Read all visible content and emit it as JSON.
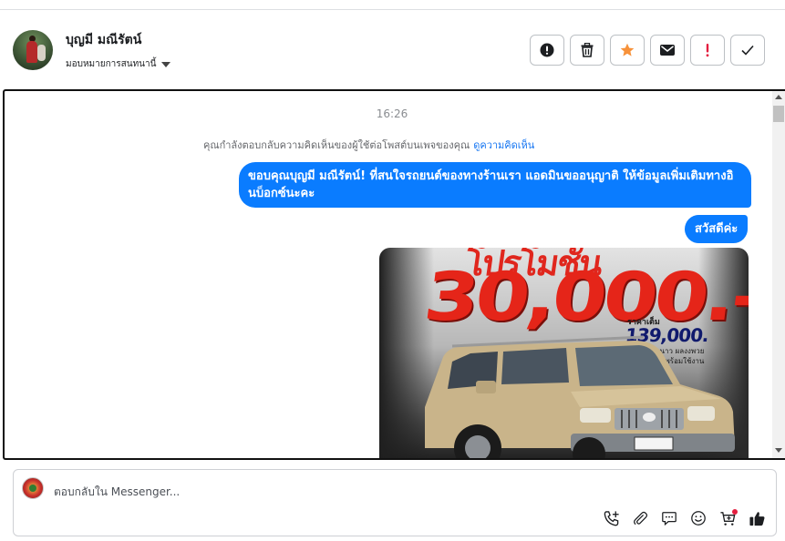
{
  "header": {
    "contact_name": "บุญมี มณีรัตน์",
    "assign_label": "มอบหมายการสนทนานี้",
    "actions": [
      {
        "name": "spam",
        "icon": "alert-circle-icon"
      },
      {
        "name": "delete",
        "icon": "trash-icon"
      },
      {
        "name": "star",
        "icon": "star-icon"
      },
      {
        "name": "mark-unread",
        "icon": "envelope-icon"
      },
      {
        "name": "follow-up",
        "icon": "exclamation-icon"
      },
      {
        "name": "done",
        "icon": "check-icon"
      }
    ]
  },
  "conversation": {
    "timestamp": "16:26",
    "notice_text": "คุณกำลังตอบกลับความคิดเห็นของผู้ใช้ต่อโพสต์บนเพจของคุณ",
    "notice_link": "ดูความคิดเห็น",
    "messages": [
      {
        "text": "ขอบคุณบุญมี มณีรัตน์! ที่สนใจรถยนต์ของทางร้านเรา แอดมินขออนุญาติ ให้ข้อมูลเพิ่มเติมทางอินบ็อกซ์นะคะ"
      },
      {
        "text": "สวัสดีค่ะ"
      }
    ],
    "image": {
      "headline": "โปรโมชั่น",
      "price_big": "30,000.-",
      "label_small": "ราคาเต็ม",
      "price_full": "139,000.",
      "note_line1": "แอร์หนาว ผลงงพวย",
      "note_line2": "พร้อมใช้งาน"
    }
  },
  "composer": {
    "placeholder": "ตอบกลับใน Messenger...",
    "tools": [
      "phone-add-icon",
      "paperclip-icon",
      "chat-bubble-icon",
      "emoji-icon",
      "cart-icon",
      "thumbs-up-icon"
    ]
  },
  "colors": {
    "accent": "#0a7cff",
    "star": "#f7923a",
    "alert": "#e41e3f",
    "link": "#1877f2"
  }
}
